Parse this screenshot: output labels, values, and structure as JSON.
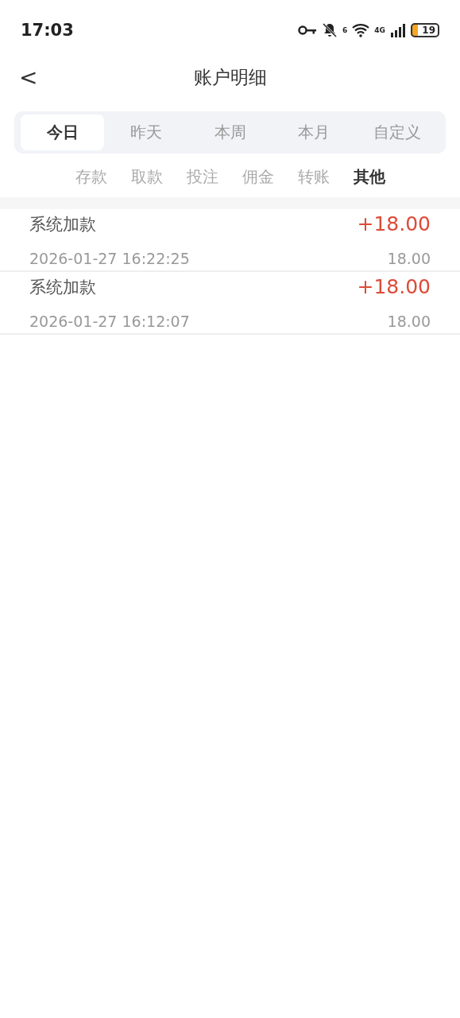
{
  "status_bar": {
    "time": "17:03",
    "wifi_label": "6",
    "network": "4G",
    "battery": "19"
  },
  "header": {
    "back": "<",
    "title": "账户明细"
  },
  "period_tabs": [
    {
      "label": "今日",
      "selected": true
    },
    {
      "label": "昨天",
      "selected": false
    },
    {
      "label": "本周",
      "selected": false
    },
    {
      "label": "本月",
      "selected": false
    },
    {
      "label": "自定义",
      "selected": false
    }
  ],
  "category_tabs": [
    {
      "label": "存款",
      "selected": false
    },
    {
      "label": "取款",
      "selected": false
    },
    {
      "label": "投注",
      "selected": false
    },
    {
      "label": "佣金",
      "selected": false
    },
    {
      "label": "转账",
      "selected": false
    },
    {
      "label": "其他",
      "selected": true
    }
  ],
  "records": [
    {
      "title": "系统加款",
      "amount": "+18.00",
      "time": "2026-01-27 16:22:25",
      "balance": "18.00"
    },
    {
      "title": "系统加款",
      "amount": "+18.00",
      "time": "2026-01-27 16:12:07",
      "balance": "18.00"
    }
  ]
}
